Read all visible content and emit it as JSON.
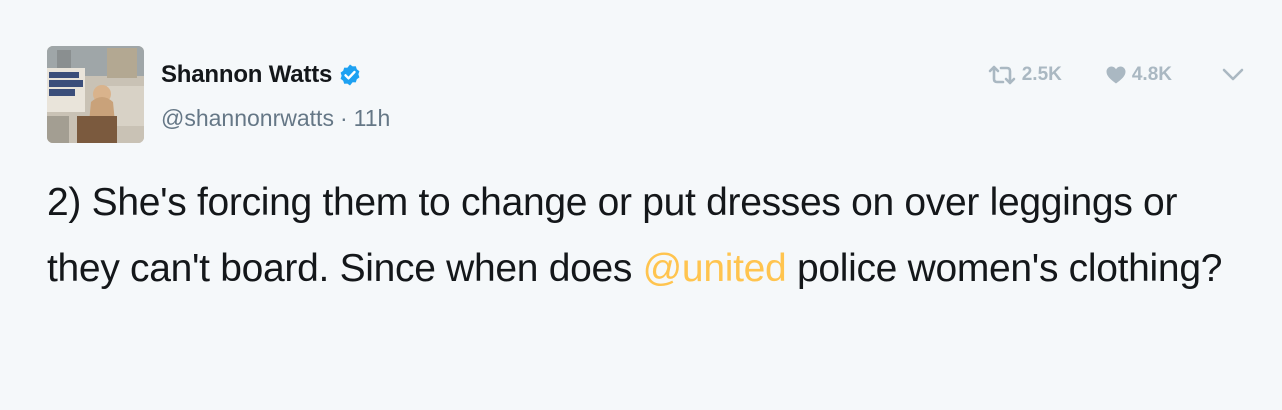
{
  "author": {
    "display_name": "Shannon Watts",
    "handle": "@shannonrwatts",
    "separator": "·",
    "time_ago": "11h",
    "verified": true
  },
  "stats": {
    "retweets": "2.5K",
    "likes": "4.8K"
  },
  "tweet": {
    "text_before": "2) She's forcing them to change or put dresses on over leggings or they can't board. Since when does ",
    "mention": "@united",
    "text_after": " police women's clothing?"
  },
  "colors": {
    "background": "#f5f8fa",
    "verified_badge": "#1da1f2",
    "mention": "#ffc44f",
    "icon_muted": "#aab8c2",
    "secondary_text": "#657786"
  },
  "icons": {
    "verified": "verified-badge-icon",
    "retweet": "retweet-icon",
    "like": "heart-icon",
    "more": "chevron-down-icon"
  }
}
